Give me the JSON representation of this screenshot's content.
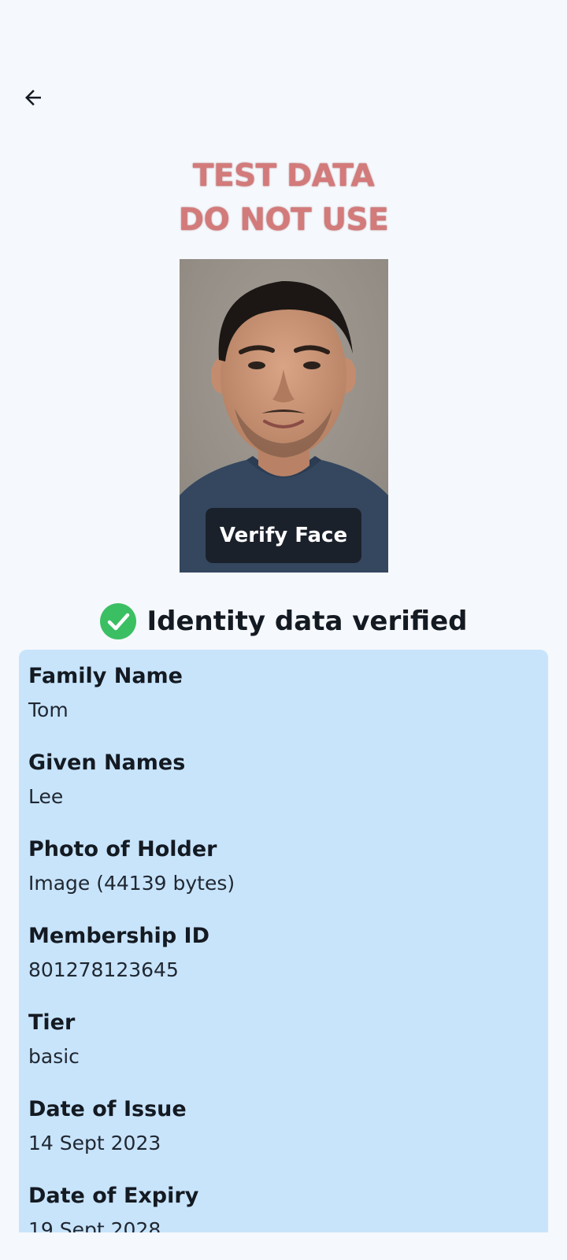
{
  "header": {
    "back_icon": "arrow-left-icon"
  },
  "watermark": {
    "line1": "TEST DATA",
    "line2": "DO NOT USE"
  },
  "portrait": {
    "verify_label": "Verify Face"
  },
  "status": {
    "icon": "check-circle-icon",
    "text": "Identity data verified",
    "color": "#3bbf63"
  },
  "fields": [
    {
      "label": "Family Name",
      "value": "Tom"
    },
    {
      "label": "Given Names",
      "value": "Lee"
    },
    {
      "label": "Photo of Holder",
      "value": "Image (44139 bytes)"
    },
    {
      "label": "Membership ID",
      "value": "801278123645"
    },
    {
      "label": "Tier",
      "value": "basic"
    },
    {
      "label": "Date of Issue",
      "value": "14 Sept 2023"
    },
    {
      "label": "Date of Expiry",
      "value": "19 Sept 2028"
    }
  ],
  "colors": {
    "background": "#f5f8fc",
    "card": "#c8e4fb",
    "watermark": "#d37a7a",
    "button": "#1b212b"
  }
}
